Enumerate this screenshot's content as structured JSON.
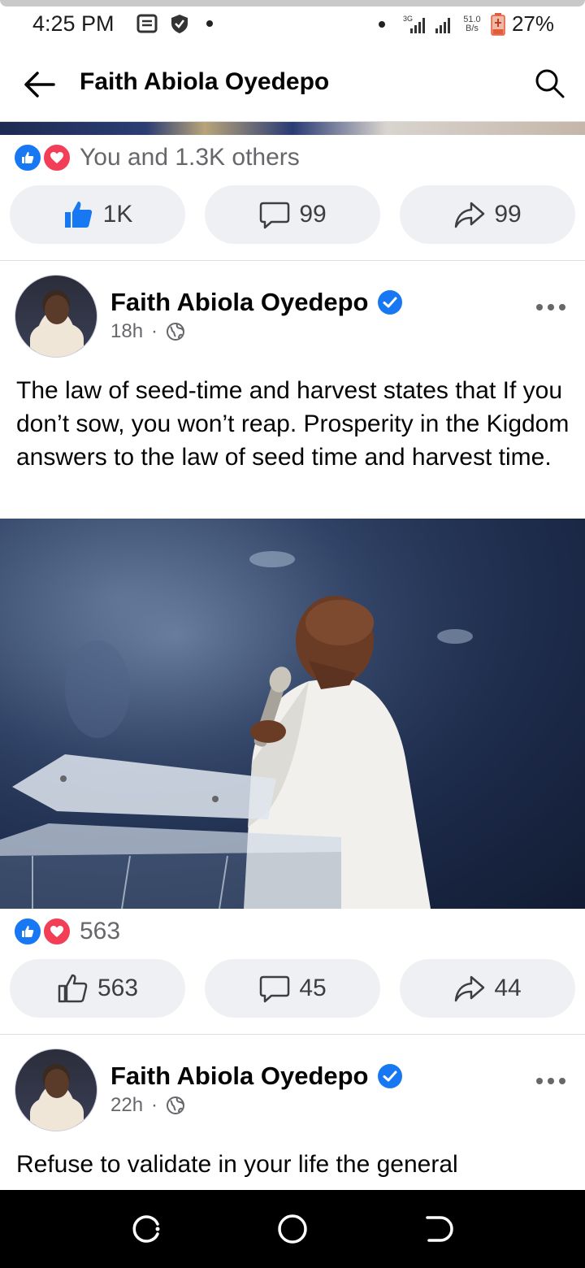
{
  "status_bar": {
    "time": "4:25 PM",
    "net_speed_value": "51.0",
    "net_speed_unit": "B/s",
    "network_type": "3G",
    "battery": "27%"
  },
  "header": {
    "title": "Faith Abiola Oyedepo",
    "back_icon": "arrow-left-icon",
    "search_icon": "search-icon"
  },
  "post_prev": {
    "reactions_text": "You and 1.3K others",
    "like_count": "1K",
    "comment_count": "99",
    "share_count": "99"
  },
  "post1": {
    "author": "Faith Abiola Oyedepo",
    "time": "18h",
    "separator": "·",
    "text": "The law of seed-time and harvest  states that If you don’t sow, you won’t reap. Prosperity in the Kigdom answers to the law of seed time and harvest time.",
    "reactions_count": "563",
    "like_count": "563",
    "comment_count": "45",
    "share_count": "44"
  },
  "post2": {
    "author": "Faith Abiola Oyedepo",
    "time": "22h",
    "separator": "·",
    "text": "Refuse to validate in your life the general"
  },
  "colors": {
    "brand_blue": "#1877f2",
    "love_red": "#f33e58",
    "secondary_text": "#65676b",
    "pill_bg": "#eef0f3"
  }
}
